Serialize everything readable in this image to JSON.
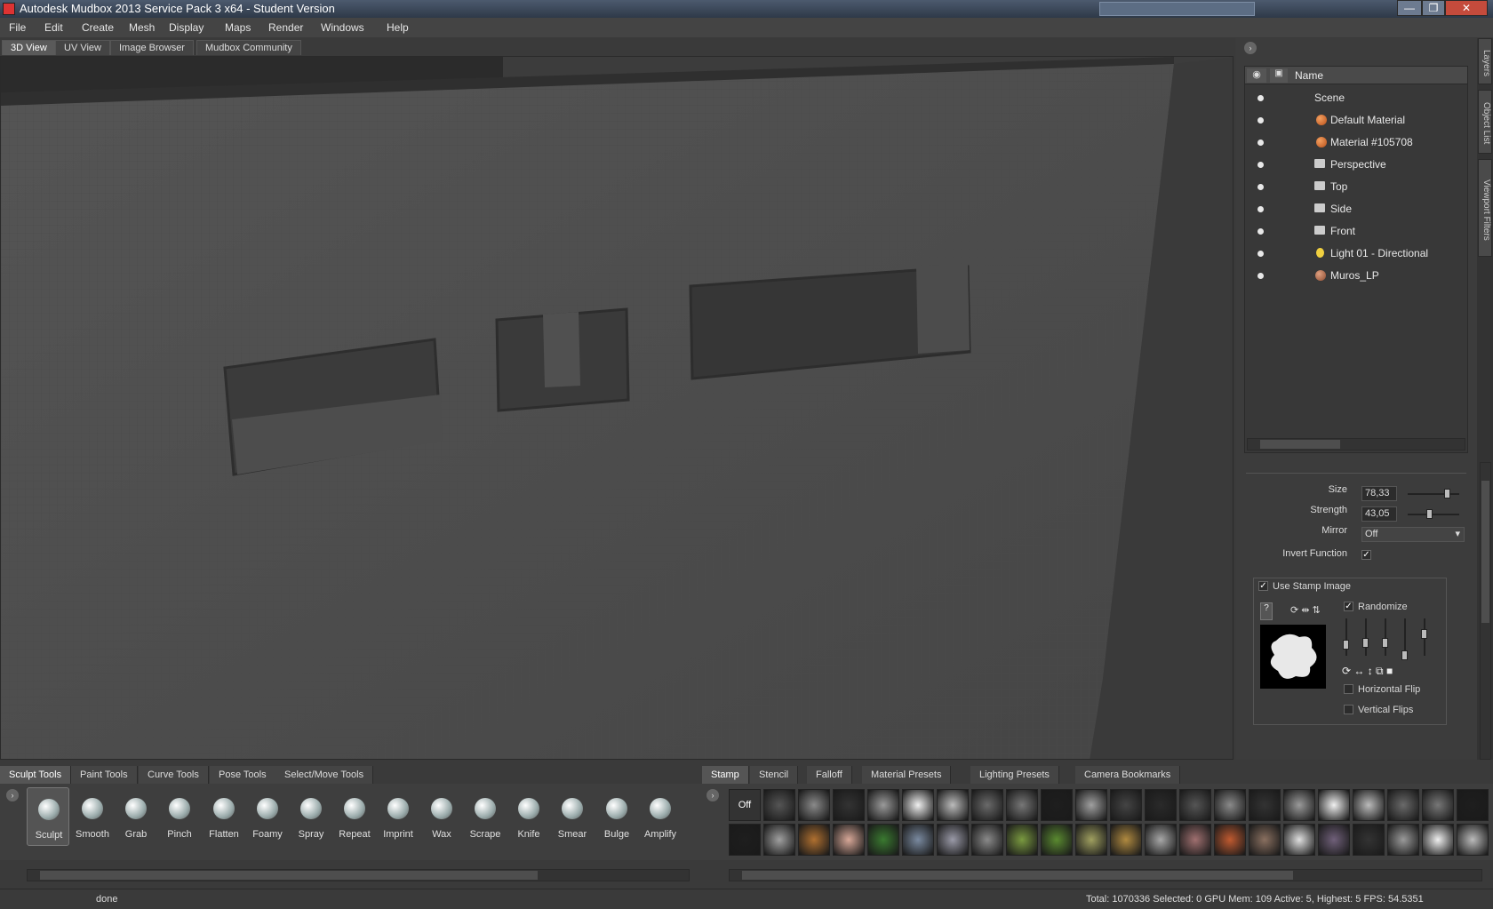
{
  "window": {
    "title": "Autodesk Mudbox 2013 Service Pack 3 x64 - Student Version",
    "min": "—",
    "max": "❐",
    "close": "✕"
  },
  "menu": [
    "File",
    "Edit",
    "Create",
    "Mesh",
    "Display",
    "Maps",
    "Render",
    "Windows",
    "Help"
  ],
  "view_tabs": [
    "3D View",
    "UV View",
    "Image Browser",
    "Mudbox Community"
  ],
  "side_tabs": [
    "Layers",
    "Object List",
    "Viewport Filters"
  ],
  "outliner": {
    "header_name": "Name",
    "items": [
      {
        "label": "Scene"
      },
      {
        "label": "Default Material"
      },
      {
        "label": "Material #105708"
      },
      {
        "label": "Perspective"
      },
      {
        "label": "Top"
      },
      {
        "label": "Side"
      },
      {
        "label": "Front"
      },
      {
        "label": "Light 01 - Directional"
      },
      {
        "label": "Muros_LP"
      }
    ]
  },
  "props": {
    "size_label": "Size",
    "size_value": "78,33",
    "size_level": 0.78,
    "strength_label": "Strength",
    "strength_value": "43,05",
    "strength_level": 0.43,
    "mirror_label": "Mirror",
    "mirror_value": "Off",
    "invert_label": "Invert Function",
    "invert_checked": "✓",
    "use_stamp_label": "Use Stamp Image",
    "use_stamp_checked": "✓",
    "randomize_label": "Randomize",
    "randomize_checked": "✓",
    "hflip_label": "Horizontal Flip",
    "vflips_label": "Vertical Flips"
  },
  "tool_tabs": [
    "Sculpt Tools",
    "Paint Tools",
    "Curve Tools",
    "Pose Tools",
    "Select/Move Tools"
  ],
  "tools": [
    "Sculpt",
    "Smooth",
    "Grab",
    "Pinch",
    "Flatten",
    "Foamy",
    "Spray",
    "Repeat",
    "Imprint",
    "Wax",
    "Scrape",
    "Knife",
    "Smear",
    "Bulge",
    "Amplify"
  ],
  "stamp_tabs": [
    "Stamp",
    "Stencil",
    "Falloff",
    "Material Presets",
    "Lighting Presets",
    "Camera Bookmarks"
  ],
  "stamp_off_label": "Off",
  "status": {
    "message": "done",
    "stats": "Total: 1070336  Selected: 0 GPU Mem: 109  Active: 5, Highest: 5  FPS: 54.5351"
  },
  "colors": {
    "accent": "#5a5a5a",
    "material_orange": "#d86b28",
    "light_yellow": "#f0d040"
  }
}
